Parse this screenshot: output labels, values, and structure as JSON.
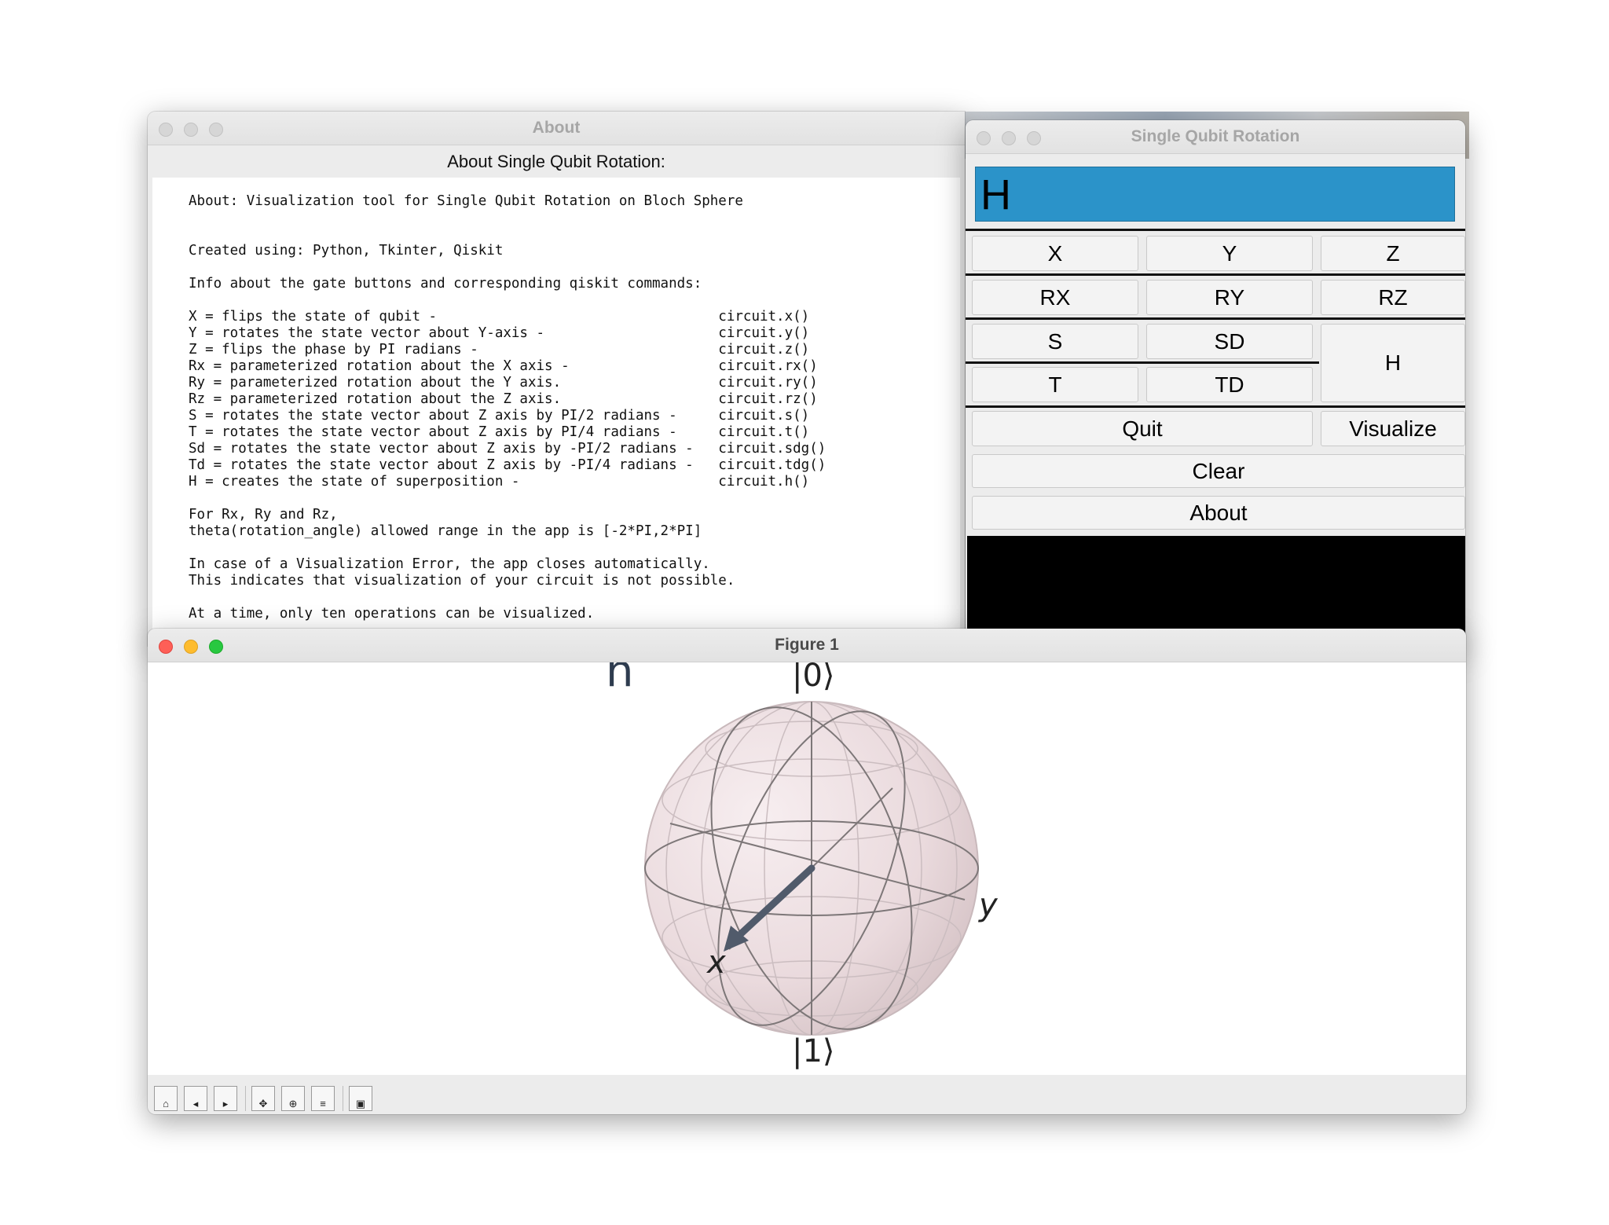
{
  "about_window": {
    "title": "About",
    "heading": "About Single Qubit Rotation:",
    "lines": [
      "About: Visualization tool for Single Qubit Rotation on Bloch Sphere",
      "",
      "",
      "Created using: Python, Tkinter, Qiskit",
      "",
      "Info about the gate buttons and corresponding qiskit commands:",
      "",
      "X = flips the state of qubit -                                  circuit.x()",
      "Y = rotates the state vector about Y-axis -                     circuit.y()",
      "Z = flips the phase by PI radians -                             circuit.z()",
      "Rx = parameterized rotation about the X axis -                  circuit.rx()",
      "Ry = parameterized rotation about the Y axis.                   circuit.ry()",
      "Rz = parameterized rotation about the Z axis.                   circuit.rz()",
      "S = rotates the state vector about Z axis by PI/2 radians -     circuit.s()",
      "T = rotates the state vector about Z axis by PI/4 radians -     circuit.t()",
      "Sd = rotates the state vector about Z axis by -PI/2 radians -   circuit.sdg()",
      "Td = rotates the state vector about Z axis by -PI/4 radians -   circuit.tdg()",
      "H = creates the state of superposition -                        circuit.h()",
      "",
      "For Rx, Ry and Rz,",
      "theta(rotation_angle) allowed range in the app is [-2*PI,2*PI]",
      "",
      "In case of a Visualization Error, the app closes automatically.",
      "This indicates that visualization of your circuit is not possible.",
      "",
      "At a time, only ten operations can be visualized."
    ]
  },
  "sqr_window": {
    "title": "Single Qubit Rotation",
    "display_value": "H",
    "buttons": {
      "x": "X",
      "y": "Y",
      "z": "Z",
      "rx": "RX",
      "ry": "RY",
      "rz": "RZ",
      "s": "S",
      "sd": "SD",
      "h": "H",
      "t": "T",
      "td": "TD",
      "quit": "Quit",
      "visualize": "Visualize",
      "clear": "Clear",
      "about": "About"
    },
    "colors": {
      "display_bg": "#2b93c9",
      "output_area": "#000000"
    }
  },
  "figure_window": {
    "title": "Figure 1",
    "plot_title_fragment": "h",
    "labels": {
      "zero": "|0⟩",
      "one": "|1⟩",
      "x": "x",
      "y": "y"
    },
    "toolbar_icons": [
      "home-icon",
      "back-icon",
      "forward-icon",
      "pan-icon",
      "zoom-icon",
      "configure-icon",
      "save-icon"
    ]
  }
}
